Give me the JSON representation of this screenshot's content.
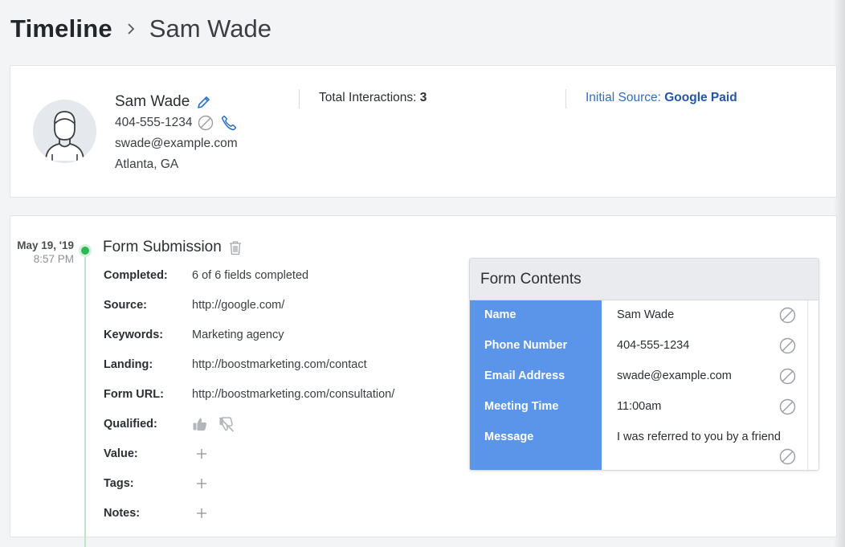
{
  "breadcrumb": {
    "root": "Timeline",
    "current": "Sam Wade"
  },
  "contact": {
    "name": "Sam Wade",
    "phone": "404-555-1234",
    "email": "swade@example.com",
    "location": "Atlanta, GA"
  },
  "stats": {
    "total_label": "Total Interactions:",
    "total_value": "3",
    "source_label": "Initial Source:",
    "source_value": "Google Paid"
  },
  "event": {
    "date": "May 19, '19",
    "time": "8:57 PM",
    "title": "Form Submission",
    "fields": [
      {
        "label": "Completed:",
        "value": "6 of 6 fields completed"
      },
      {
        "label": "Source:",
        "value": "http://google.com/"
      },
      {
        "label": "Keywords:",
        "value": "Marketing agency"
      },
      {
        "label": "Landing:",
        "value": "http://boostmarketing.com/contact"
      },
      {
        "label": "Form URL:",
        "value": "http://boostmarketing.com/consultation/"
      },
      {
        "label": "Qualified:",
        "value": ""
      },
      {
        "label": "Value:",
        "value": ""
      },
      {
        "label": "Tags:",
        "value": ""
      },
      {
        "label": "Notes:",
        "value": ""
      }
    ]
  },
  "form_contents": {
    "title": "Form Contents",
    "rows": [
      {
        "label": "Name",
        "value": "Sam Wade"
      },
      {
        "label": "Phone Number",
        "value": "404-555-1234"
      },
      {
        "label": "Email Address",
        "value": "swade@example.com"
      },
      {
        "label": "Meeting Time",
        "value": "11:00am"
      },
      {
        "label": "Message",
        "value": "I was referred to you by a friend"
      }
    ]
  },
  "icons": {
    "edit": "pencil-icon",
    "block": "block-icon",
    "call": "phone-icon",
    "delete": "trash-icon",
    "qualified_yes": "thumbs-up-icon",
    "qualified_no": "thumbs-down-off-icon",
    "add": "plus-icon"
  },
  "colors": {
    "accent": "#2a6fc9",
    "timeline_dot": "#2db856",
    "form_label_bg": "#5b95e9"
  }
}
